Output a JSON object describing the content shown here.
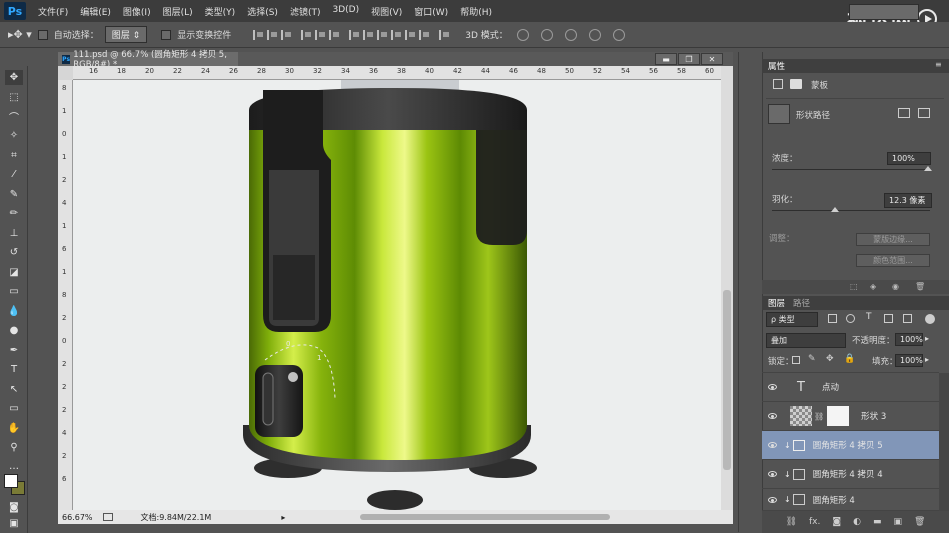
{
  "app": {
    "logo": "Ps"
  },
  "menu": [
    "文件(F)",
    "编辑(E)",
    "图像(I)",
    "图层(L)",
    "类型(Y)",
    "选择(S)",
    "滤镜(T)",
    "3D(D)",
    "视图(V)",
    "窗口(W)",
    "帮助(H)"
  ],
  "watermark": "视达网",
  "options": {
    "auto_select_label": "自动选择：",
    "auto_select_value": "图层",
    "show_transform_label": "显示变换控件",
    "mode3d_label": "3D 模式："
  },
  "document": {
    "tab_title": "111.psd @ 66.7% (圆角矩形 4 拷贝 5, RGB/8#) *",
    "zoom": "66.67%",
    "doc_size": "文档:9.84M/22.1M",
    "ruler_top": [
      "16",
      "18",
      "20",
      "22",
      "24",
      "26",
      "28",
      "30",
      "32",
      "34",
      "36",
      "38",
      "40",
      "42",
      "44",
      "46",
      "48",
      "50",
      "52",
      "54",
      "56",
      "58",
      "60"
    ],
    "ruler_left": [
      "8",
      "1",
      "0",
      "1",
      "2",
      "4",
      "1",
      "6",
      "1",
      "8",
      "2",
      "0",
      "2",
      "2",
      "2",
      "4",
      "2",
      "6"
    ]
  },
  "properties": {
    "tab": "属性",
    "mask_tab": "蒙板",
    "shape_path_label": "形状路径",
    "density_label": "浓度：",
    "density_value": "100%",
    "density_level": 1.0,
    "feather_label": "羽化：",
    "feather_value": "12.3 像素",
    "adjust_label": "调整：",
    "mask_edge_btn": "蒙版边缘...",
    "color_range_btn": "颜色范围..."
  },
  "layers": {
    "tabs": [
      "图层",
      "路径"
    ],
    "filter_kind": "ρ 类型",
    "blend_mode": "叠加",
    "opacity_label": "不透明度：",
    "opacity_value": "100%",
    "lock_label": "锁定：",
    "fill_label": "填充：",
    "fill_value": "100%",
    "items": [
      {
        "name": "点动",
        "type": "text"
      },
      {
        "name": "形状 3",
        "type": "shape-mask"
      },
      {
        "name": "圆角矩形 4 拷贝 5",
        "type": "shape",
        "selected": true
      },
      {
        "name": "圆角矩形 4 拷贝 4",
        "type": "shape"
      },
      {
        "name": "圆角矩形 4",
        "type": "shape"
      }
    ]
  },
  "colors": {
    "accent_selected": "#8196b8",
    "foreground": "#ffffff",
    "background": "#7a7b36"
  }
}
